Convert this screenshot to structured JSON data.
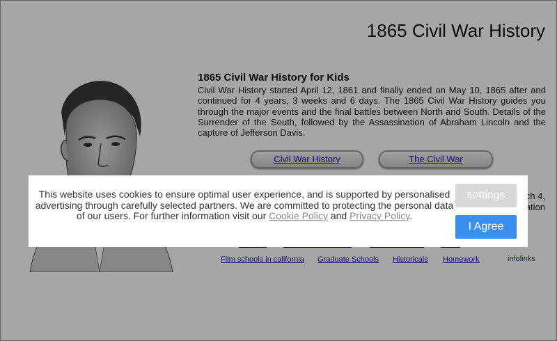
{
  "site": {
    "title": "1865 Civil War History"
  },
  "article": {
    "heading": "1865 Civil War History for Kids",
    "body": "Civil War History started April 12, 1861 and finally ended on May 10, 1865 after  and continued for 4 years, 3 weeks and 6 days. The 1865 Civil War History guides you through the major events and the final battles between North and South. Details of the Surrender of the South, followed by the Assassination of Abraham Lincoln and the capture of Jefferson Davis."
  },
  "nav_buttons": [
    "Civil War History",
    "The Civil War"
  ],
  "partial_text": {
    "line1": "ch 4,",
    "line2": "ation"
  },
  "footer_links": [
    "Film schools in california",
    "Graduate Schools",
    "Historicals",
    "Homework"
  ],
  "infolinks": "infolinks",
  "cookie_banner": {
    "message_before": "This website uses cookies to ensure optimal user experience, and is supported by personalised advertising through carefully selected partners. We are committed to protecting the personal data of our users. For further information visit our ",
    "cookie_policy": "Cookie Policy",
    "and": " and ",
    "privacy_policy": "Privacy Policy",
    "period": ".",
    "settings_label": "settings",
    "agree_label": "I Agree"
  },
  "colors": {
    "overlay": "#000000",
    "agree_button": "#3a8ef0",
    "settings_button": "#d9d9d9",
    "link": "#1a0dab"
  },
  "icons": {
    "portrait": "abraham-lincoln-portrait"
  }
}
